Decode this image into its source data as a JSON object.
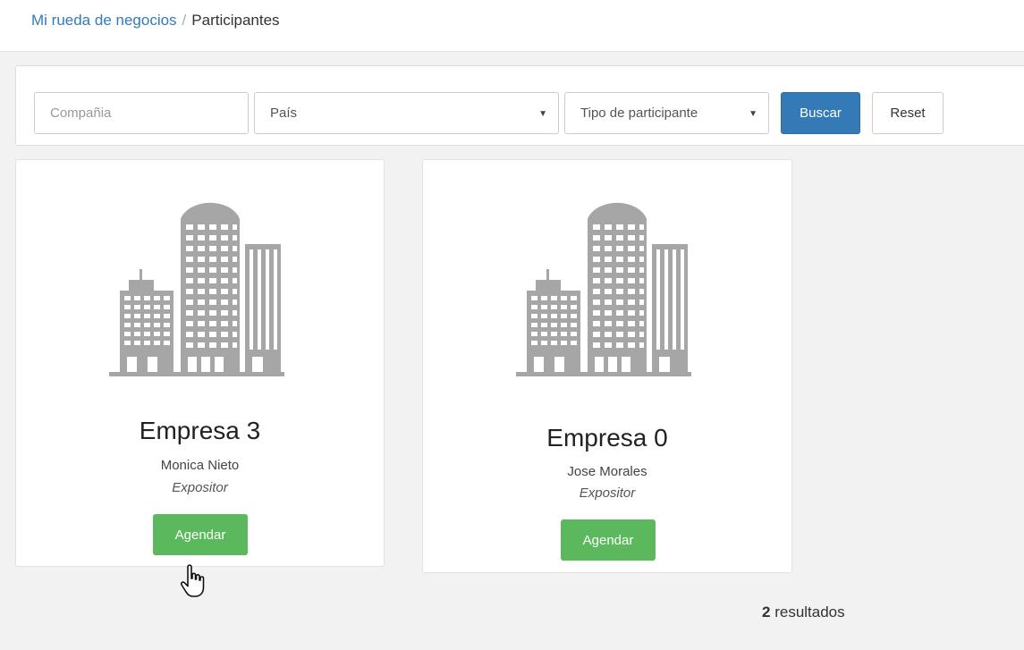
{
  "breadcrumb": {
    "parent": "Mi rueda de negocios",
    "separator": "/",
    "current": "Participantes"
  },
  "filters": {
    "company_placeholder": "Compañia",
    "country_label": "País",
    "type_label": "Tipo de participante",
    "search_label": "Buscar",
    "reset_label": "Reset"
  },
  "participants": [
    {
      "company": "Empresa 3",
      "contact": "Monica Nieto",
      "role": "Expositor",
      "action": "Agendar",
      "icon": "building-icon"
    },
    {
      "company": "Empresa 0",
      "contact": "Jose Morales",
      "role": "Expositor",
      "action": "Agendar",
      "icon": "building-icon"
    }
  ],
  "results": {
    "count": "2",
    "label": "resultados"
  },
  "colors": {
    "primary": "#337ab7",
    "success": "#5cb85c",
    "icon": "#a6a6a6",
    "background": "#f2f2f2"
  }
}
